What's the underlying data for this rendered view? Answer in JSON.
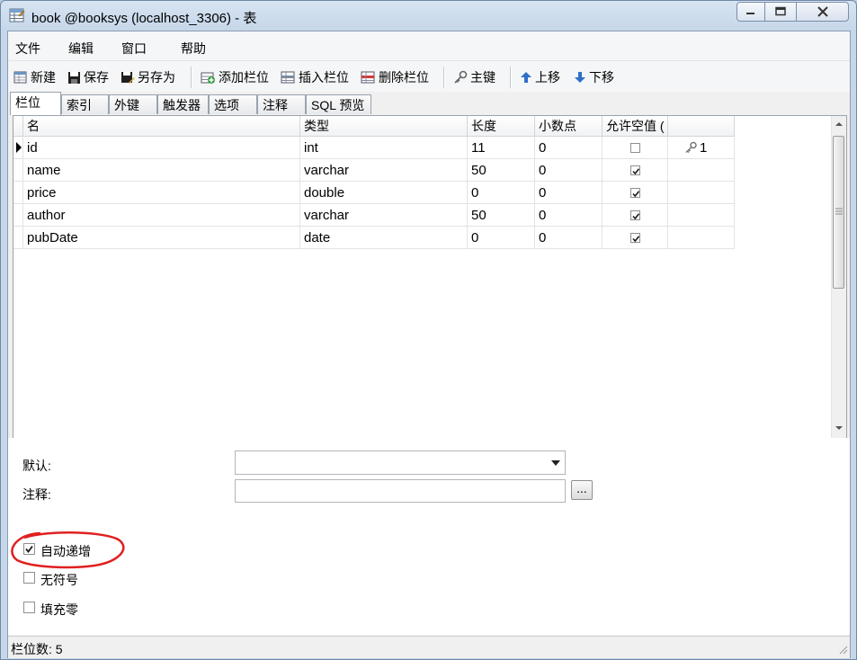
{
  "window": {
    "title": "book @booksys (localhost_3306) - 表"
  },
  "menu": [
    "文件",
    "编辑",
    "窗口",
    "帮助"
  ],
  "toolbar": {
    "new": "新建",
    "save": "保存",
    "save_as": "另存为",
    "add_field": "添加栏位",
    "insert_field": "插入栏位",
    "delete_field": "删除栏位",
    "primary_key": "主键",
    "move_up": "上移",
    "move_down": "下移"
  },
  "tabs": [
    "栏位",
    "索引",
    "外键",
    "触发器",
    "选项",
    "注释",
    "SQL 预览"
  ],
  "grid": {
    "headers": [
      "名",
      "类型",
      "长度",
      "小数点",
      "允许空值 ("
    ],
    "rows": [
      {
        "name": "id",
        "type": "int",
        "length": "11",
        "decimals": "0",
        "nullable": false,
        "key": "1"
      },
      {
        "name": "name",
        "type": "varchar",
        "length": "50",
        "decimals": "0",
        "nullable": true,
        "key": ""
      },
      {
        "name": "price",
        "type": "double",
        "length": "0",
        "decimals": "0",
        "nullable": true,
        "key": ""
      },
      {
        "name": "author",
        "type": "varchar",
        "length": "50",
        "decimals": "0",
        "nullable": true,
        "key": ""
      },
      {
        "name": "pubDate",
        "type": "date",
        "length": "0",
        "decimals": "0",
        "nullable": true,
        "key": ""
      }
    ]
  },
  "properties": {
    "default_label": "默认:",
    "default_value": "",
    "comment_label": "注释:",
    "comment_value": "",
    "comment_button": "...",
    "auto_increment_label": "自动递增",
    "auto_increment": true,
    "unsigned_label": "无符号",
    "unsigned": false,
    "zerofill_label": "填充零",
    "zerofill": false
  },
  "status": {
    "field_count": "栏位数: 5"
  },
  "colors": {
    "annotation": "#e02020",
    "window_frame": "#c6d7ea"
  }
}
